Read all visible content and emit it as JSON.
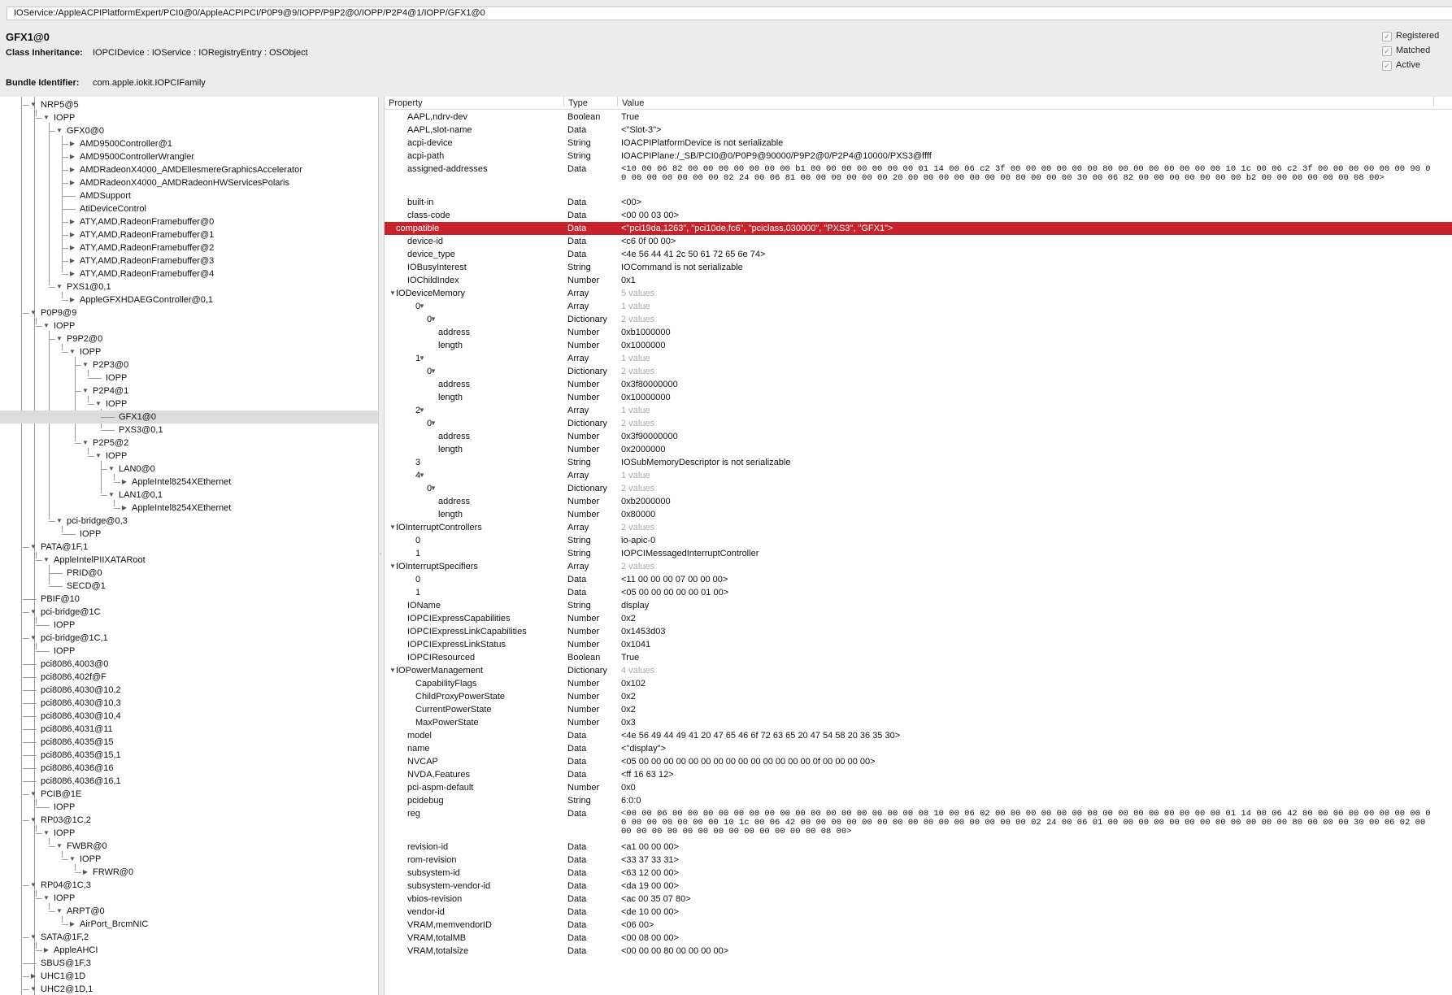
{
  "window": {
    "path": "IOService:/AppleACPIPlatformExpert/PCI0@0/AppleACPIPCI/P0P9@9/IOPP/P9P2@0/IOPP/P2P4@1/IOPP/GFX1@0"
  },
  "header": {
    "title": "GFX1@0",
    "class_inheritance_label": "Class Inheritance:",
    "class_inheritance_value": "IOPCIDevice : IOService : IORegistryEntry : OSObject",
    "bundle_identifier_label": "Bundle Identifier:",
    "bundle_identifier_value": "com.apple.iokit.IOPCIFamily",
    "checks": [
      {
        "label": "Registered",
        "checked": true
      },
      {
        "label": "Matched",
        "checked": true
      },
      {
        "label": "Active",
        "checked": true
      }
    ]
  },
  "tree": {
    "selected_label": "GFX1@0",
    "rows": [
      {
        "d": 5,
        "label": "NRP5@5",
        "tri": "open"
      },
      {
        "d": 6,
        "label": "IOPP",
        "tri": "open"
      },
      {
        "d": 7,
        "label": "GFX0@0",
        "tri": "open"
      },
      {
        "d": 8,
        "label": "AMD9500Controller@1",
        "tri": "closed"
      },
      {
        "d": 8,
        "label": "AMD9500ControllerWrangler",
        "tri": "closed"
      },
      {
        "d": 8,
        "label": "AMDRadeonX4000_AMDEllesmereGraphicsAccelerator",
        "tri": "closed"
      },
      {
        "d": 8,
        "label": "AMDRadeonX4000_AMDRadeonHWServicesPolaris",
        "tri": "closed"
      },
      {
        "d": 8,
        "label": "AMDSupport",
        "tri": "none"
      },
      {
        "d": 8,
        "label": "AtiDeviceControl",
        "tri": "none"
      },
      {
        "d": 8,
        "label": "ATY,AMD,RadeonFramebuffer@0",
        "tri": "closed"
      },
      {
        "d": 8,
        "label": "ATY,AMD,RadeonFramebuffer@1",
        "tri": "closed"
      },
      {
        "d": 8,
        "label": "ATY,AMD,RadeonFramebuffer@2",
        "tri": "closed"
      },
      {
        "d": 8,
        "label": "ATY,AMD,RadeonFramebuffer@3",
        "tri": "closed"
      },
      {
        "d": 8,
        "label": "ATY,AMD,RadeonFramebuffer@4",
        "tri": "closed"
      },
      {
        "d": 7,
        "label": "PXS1@0,1",
        "tri": "open"
      },
      {
        "d": 8,
        "label": "AppleGFXHDAEGController@0,1",
        "tri": "closed"
      },
      {
        "d": 5,
        "label": "P0P9@9",
        "tri": "open"
      },
      {
        "d": 6,
        "label": "IOPP",
        "tri": "open"
      },
      {
        "d": 7,
        "label": "P9P2@0",
        "tri": "open"
      },
      {
        "d": 8,
        "label": "IOPP",
        "tri": "open"
      },
      {
        "d": 9,
        "label": "P2P3@0",
        "tri": "open"
      },
      {
        "d": 10,
        "label": "IOPP",
        "tri": "none"
      },
      {
        "d": 9,
        "label": "P2P4@1",
        "tri": "open"
      },
      {
        "d": 10,
        "label": "IOPP",
        "tri": "open"
      },
      {
        "d": 11,
        "label": "GFX1@0",
        "tri": "none",
        "sel": true
      },
      {
        "d": 11,
        "label": "PXS3@0,1",
        "tri": "none"
      },
      {
        "d": 9,
        "label": "P2P5@2",
        "tri": "open"
      },
      {
        "d": 10,
        "label": "IOPP",
        "tri": "open"
      },
      {
        "d": 11,
        "label": "LAN0@0",
        "tri": "open"
      },
      {
        "d": 12,
        "label": "AppleIntel8254XEthernet",
        "tri": "closed"
      },
      {
        "d": 11,
        "label": "LAN1@0,1",
        "tri": "open"
      },
      {
        "d": 12,
        "label": "AppleIntel8254XEthernet",
        "tri": "closed"
      },
      {
        "d": 7,
        "label": "pci-bridge@0,3",
        "tri": "open"
      },
      {
        "d": 8,
        "label": "IOPP",
        "tri": "none"
      },
      {
        "d": 5,
        "label": "PATA@1F,1",
        "tri": "open"
      },
      {
        "d": 6,
        "label": "AppleIntelPIIXATARoot",
        "tri": "open"
      },
      {
        "d": 7,
        "label": "PRID@0",
        "tri": "none"
      },
      {
        "d": 7,
        "label": "SECD@1",
        "tri": "none"
      },
      {
        "d": 5,
        "label": "PBIF@10",
        "tri": "none"
      },
      {
        "d": 5,
        "label": "pci-bridge@1C",
        "tri": "open"
      },
      {
        "d": 6,
        "label": "IOPP",
        "tri": "none"
      },
      {
        "d": 5,
        "label": "pci-bridge@1C,1",
        "tri": "open"
      },
      {
        "d": 6,
        "label": "IOPP",
        "tri": "none"
      },
      {
        "d": 5,
        "label": "pci8086,4003@0",
        "tri": "none"
      },
      {
        "d": 5,
        "label": "pci8086,402f@F",
        "tri": "none"
      },
      {
        "d": 5,
        "label": "pci8086,4030@10,2",
        "tri": "none"
      },
      {
        "d": 5,
        "label": "pci8086,4030@10,3",
        "tri": "none"
      },
      {
        "d": 5,
        "label": "pci8086,4030@10,4",
        "tri": "none"
      },
      {
        "d": 5,
        "label": "pci8086,4031@11",
        "tri": "none"
      },
      {
        "d": 5,
        "label": "pci8086,4035@15",
        "tri": "none"
      },
      {
        "d": 5,
        "label": "pci8086,4035@15,1",
        "tri": "none"
      },
      {
        "d": 5,
        "label": "pci8086,4036@16",
        "tri": "none"
      },
      {
        "d": 5,
        "label": "pci8086,4036@16,1",
        "tri": "none"
      },
      {
        "d": 5,
        "label": "PCIB@1E",
        "tri": "open"
      },
      {
        "d": 6,
        "label": "IOPP",
        "tri": "none"
      },
      {
        "d": 5,
        "label": "RP03@1C,2",
        "tri": "open"
      },
      {
        "d": 6,
        "label": "IOPP",
        "tri": "open"
      },
      {
        "d": 7,
        "label": "FWBR@0",
        "tri": "open"
      },
      {
        "d": 8,
        "label": "IOPP",
        "tri": "open"
      },
      {
        "d": 9,
        "label": "FRWR@0",
        "tri": "closed"
      },
      {
        "d": 5,
        "label": "RP04@1C,3",
        "tri": "open"
      },
      {
        "d": 6,
        "label": "IOPP",
        "tri": "open"
      },
      {
        "d": 7,
        "label": "ARPT@0",
        "tri": "open"
      },
      {
        "d": 8,
        "label": "AirPort_BrcmNIC",
        "tri": "closed"
      },
      {
        "d": 5,
        "label": "SATA@1F,2",
        "tri": "open"
      },
      {
        "d": 6,
        "label": "AppleAHCI",
        "tri": "closed"
      },
      {
        "d": 5,
        "label": "SBUS@1F,3",
        "tri": "none"
      },
      {
        "d": 5,
        "label": "UHC1@1D",
        "tri": "closed"
      },
      {
        "d": 5,
        "label": "UHC2@1D,1",
        "tri": "open"
      }
    ]
  },
  "properties": {
    "columns": {
      "property": "Property",
      "type": "Type",
      "value": "Value"
    },
    "selected_key": "compatible",
    "rows": [
      {
        "k": "AAPL,ndrv-dev",
        "i": 1,
        "t": "Boolean",
        "v": "True"
      },
      {
        "k": "AAPL,slot-name",
        "i": 1,
        "t": "Data",
        "v": "<\"Slot-3\">"
      },
      {
        "k": "acpi-device",
        "i": 1,
        "t": "String",
        "v": "IOACPIPlatformDevice is not serializable"
      },
      {
        "k": "acpi-path",
        "i": 1,
        "t": "String",
        "v": "IOACPIPlane:/_SB/PCI0@0/P0P9@90000/P9P2@0/P2P4@10000/PXS3@ffff"
      },
      {
        "k": "assigned-addresses",
        "i": 1,
        "t": "Data",
        "v": "<10 00 06 82 00 00 00 00 00 00 00 b1 00 00 00 00 00 00 00 01 14 00 06 c2 3f 00 00 00 00 00 00 80 00 00 00 00 00 00 00 10 1c 00 06 c2 3f 00 00 00 00 00 00 90 00 00 00 00 00 00 00 02 24 00 06 81 00 00 00 00 00 00 20 00 00 00 00 00 00 00 80 00 00 00 30 00 06 82 00 00 00 00 00 00 00 b2 00 00 00 00 00 00 08 00>",
        "mono": true,
        "lines": 3
      },
      {
        "k": "built-in",
        "i": 1,
        "t": "Data",
        "v": "<00>"
      },
      {
        "k": "class-code",
        "i": 1,
        "t": "Data",
        "v": "<00 00 03 00>"
      },
      {
        "k": "compatible",
        "i": 0,
        "t": "Data",
        "v": "<\"pci19da,1263\", \"pci10de,fc6\", \"pciclass,030000\", \"PXS3\", \"GFX1\">",
        "sel": true
      },
      {
        "k": "device-id",
        "i": 1,
        "t": "Data",
        "v": "<c6 0f 00 00>"
      },
      {
        "k": "device_type",
        "i": 1,
        "t": "Data",
        "v": "<4e 56 44 41 2c 50 61 72 65 6e 74>"
      },
      {
        "k": "IOBusyInterest",
        "i": 1,
        "t": "String",
        "v": "IOCommand is not serializable"
      },
      {
        "k": "IOChildIndex",
        "i": 1,
        "t": "Number",
        "v": "0x1"
      },
      {
        "k": "IODeviceMemory",
        "i": 0,
        "t": "Array",
        "v": "5 values",
        "grey": true,
        "tri": true
      },
      {
        "k": "0",
        "i": 2,
        "t": "Array",
        "v": "1 value",
        "grey": true,
        "tri": true
      },
      {
        "k": "0",
        "i": 3,
        "t": "Dictionary",
        "v": "2 values",
        "grey": true,
        "tri": true
      },
      {
        "k": "address",
        "i": 4,
        "t": "Number",
        "v": "0xb1000000"
      },
      {
        "k": "length",
        "i": 4,
        "t": "Number",
        "v": "0x1000000"
      },
      {
        "k": "1",
        "i": 2,
        "t": "Array",
        "v": "1 value",
        "grey": true,
        "tri": true
      },
      {
        "k": "0",
        "i": 3,
        "t": "Dictionary",
        "v": "2 values",
        "grey": true,
        "tri": true
      },
      {
        "k": "address",
        "i": 4,
        "t": "Number",
        "v": "0x3f80000000"
      },
      {
        "k": "length",
        "i": 4,
        "t": "Number",
        "v": "0x10000000"
      },
      {
        "k": "2",
        "i": 2,
        "t": "Array",
        "v": "1 value",
        "grey": true,
        "tri": true
      },
      {
        "k": "0",
        "i": 3,
        "t": "Dictionary",
        "v": "2 values",
        "grey": true,
        "tri": true
      },
      {
        "k": "address",
        "i": 4,
        "t": "Number",
        "v": "0x3f90000000"
      },
      {
        "k": "length",
        "i": 4,
        "t": "Number",
        "v": "0x2000000"
      },
      {
        "k": "3",
        "i": 2,
        "t": "String",
        "v": "IOSubMemoryDescriptor is not serializable"
      },
      {
        "k": "4",
        "i": 2,
        "t": "Array",
        "v": "1 value",
        "grey": true,
        "tri": true
      },
      {
        "k": "0",
        "i": 3,
        "t": "Dictionary",
        "v": "2 values",
        "grey": true,
        "tri": true
      },
      {
        "k": "address",
        "i": 4,
        "t": "Number",
        "v": "0xb2000000"
      },
      {
        "k": "length",
        "i": 4,
        "t": "Number",
        "v": "0x80000"
      },
      {
        "k": "IOInterruptControllers",
        "i": 0,
        "t": "Array",
        "v": "2 values",
        "grey": true,
        "tri": true
      },
      {
        "k": "0",
        "i": 2,
        "t": "String",
        "v": "io-apic-0"
      },
      {
        "k": "1",
        "i": 2,
        "t": "String",
        "v": "IOPCIMessagedInterruptController"
      },
      {
        "k": "IOInterruptSpecifiers",
        "i": 0,
        "t": "Array",
        "v": "2 values",
        "grey": true,
        "tri": true
      },
      {
        "k": "0",
        "i": 2,
        "t": "Data",
        "v": "<11 00 00 00 07 00 00 00>"
      },
      {
        "k": "1",
        "i": 2,
        "t": "Data",
        "v": "<05 00 00 00 00 00 01 00>"
      },
      {
        "k": "IOName",
        "i": 1,
        "t": "String",
        "v": "display"
      },
      {
        "k": "IOPCIExpressCapabilities",
        "i": 1,
        "t": "Number",
        "v": "0x2"
      },
      {
        "k": "IOPCIExpressLinkCapabilities",
        "i": 1,
        "t": "Number",
        "v": "0x1453d03"
      },
      {
        "k": "IOPCIExpressLinkStatus",
        "i": 1,
        "t": "Number",
        "v": "0x1041"
      },
      {
        "k": "IOPCIResourced",
        "i": 1,
        "t": "Boolean",
        "v": "True"
      },
      {
        "k": "IOPowerManagement",
        "i": 0,
        "t": "Dictionary",
        "v": "4 values",
        "grey": true,
        "tri": true
      },
      {
        "k": "CapabilityFlags",
        "i": 2,
        "t": "Number",
        "v": "0x102"
      },
      {
        "k": "ChildProxyPowerState",
        "i": 2,
        "t": "Number",
        "v": "0x2"
      },
      {
        "k": "CurrentPowerState",
        "i": 2,
        "t": "Number",
        "v": "0x2"
      },
      {
        "k": "MaxPowerState",
        "i": 2,
        "t": "Number",
        "v": "0x3"
      },
      {
        "k": "model",
        "i": 1,
        "t": "Data",
        "v": "<4e 56 49 44 49 41 20 47 65 46 6f 72 63 65 20 47 54 58 20 36 35 30>"
      },
      {
        "k": "name",
        "i": 1,
        "t": "Data",
        "v": "<\"display\">"
      },
      {
        "k": "NVCAP",
        "i": 1,
        "t": "Data",
        "v": "<05 00 00 00 00 00 00 00 00 00 00 00 00 00 00 0f 00 00 00 00>"
      },
      {
        "k": "NVDA,Features",
        "i": 1,
        "t": "Data",
        "v": "<ff 16 63 12>"
      },
      {
        "k": "pci-aspm-default",
        "i": 1,
        "t": "Number",
        "v": "0x0"
      },
      {
        "k": "pcidebug",
        "i": 1,
        "t": "String",
        "v": "6:0:0"
      },
      {
        "k": "reg",
        "i": 1,
        "t": "Data",
        "v": "<00 00 06 00 00 00 00 00 00 00 00 00 00 00 00 00 00 00 00 00 10 00 06 02 00 00 00 00 00 00 00 00 00 00 00 00 00 00 00 01 14 00 06 42 00 00 00 00 00 00 00 00 00 00 00 00 00 00 00 10 1c 00 06 42 00 00 00 00 00 00 00 00 00 00 00 00 00 00 00 02 24 00 06 01 00 00 00 00 00 00 00 00 00 00 00 00 80 00 00 00 30 00 06 02 00 00 00 00 00 00 00 00 00 00 00 00 00 00 08 00>",
        "mono": true,
        "lines": 3
      },
      {
        "k": "revision-id",
        "i": 1,
        "t": "Data",
        "v": "<a1 00 00 00>"
      },
      {
        "k": "rom-revision",
        "i": 1,
        "t": "Data",
        "v": "<33 37 33 31>"
      },
      {
        "k": "subsystem-id",
        "i": 1,
        "t": "Data",
        "v": "<63 12 00 00>"
      },
      {
        "k": "subsystem-vendor-id",
        "i": 1,
        "t": "Data",
        "v": "<da 19 00 00>"
      },
      {
        "k": "vbios-revision",
        "i": 1,
        "t": "Data",
        "v": "<ac 00 35 07 80>"
      },
      {
        "k": "vendor-id",
        "i": 1,
        "t": "Data",
        "v": "<de 10 00 00>"
      },
      {
        "k": "VRAM,memvendorID",
        "i": 1,
        "t": "Data",
        "v": "<06 00>"
      },
      {
        "k": "VRAM,totalMB",
        "i": 1,
        "t": "Data",
        "v": "<00 08 00 00>"
      },
      {
        "k": "VRAM,totalsize",
        "i": 1,
        "t": "Data",
        "v": "<00 00 00 80 00 00 00 00>"
      }
    ]
  },
  "colors": {
    "selection_red": "#c8232c",
    "tree_selection": "#dcdcdc"
  }
}
